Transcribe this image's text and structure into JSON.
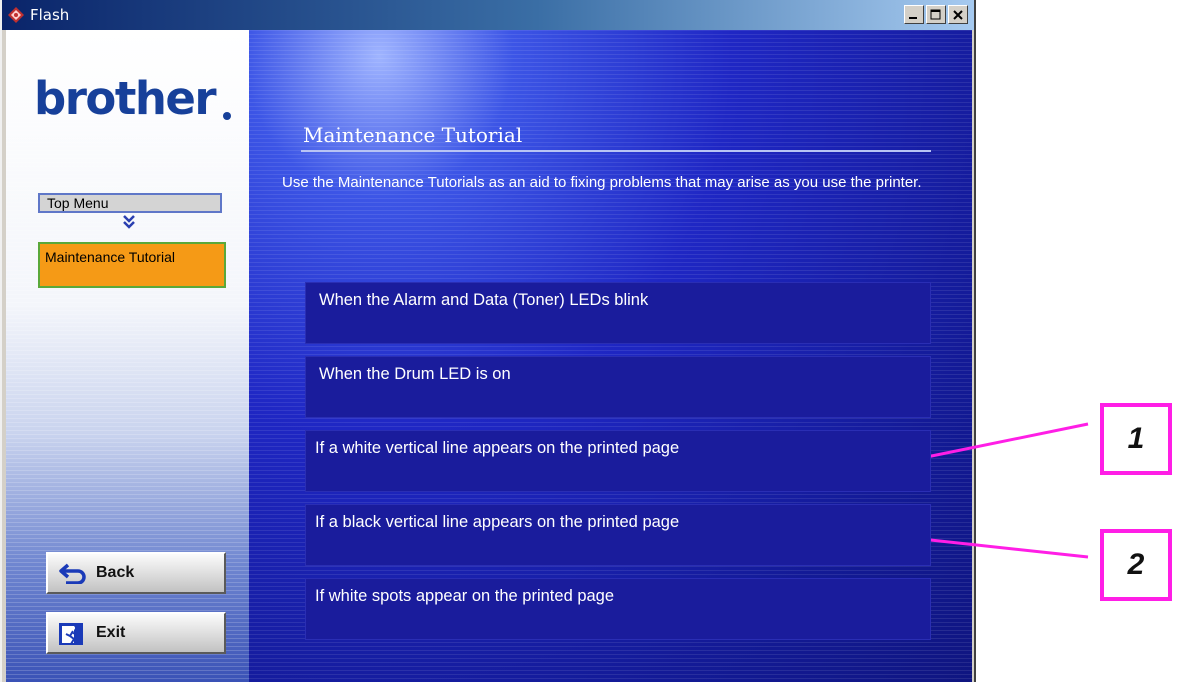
{
  "window": {
    "title": "Flash",
    "controls": [
      "minimize",
      "maximize",
      "close"
    ]
  },
  "sidebar": {
    "logo": "brother",
    "breadcrumb": {
      "top_menu": "Top Menu",
      "current": "Maintenance Tutorial"
    },
    "back_label": "Back",
    "exit_label": "Exit"
  },
  "main": {
    "title": "Maintenance Tutorial",
    "intro": "Use the Maintenance Tutorials as an aid to fixing problems that may arise as you use the printer.",
    "topics": [
      "When the Alarm and Data (Toner) LEDs blink",
      "When the Drum LED is on",
      "If a white vertical line appears on the printed page",
      "If a black vertical line appears on the printed page",
      "If white spots appear on the printed page"
    ]
  },
  "callouts": [
    "1",
    "2"
  ],
  "colors": {
    "title_bar": "#0a246a",
    "main_background": "#1f27c4",
    "topic_box": "#1a1c9c",
    "breadcrumb_current": "#f59a16",
    "callout_border": "#ff1ee6",
    "logo": "#17409a"
  }
}
